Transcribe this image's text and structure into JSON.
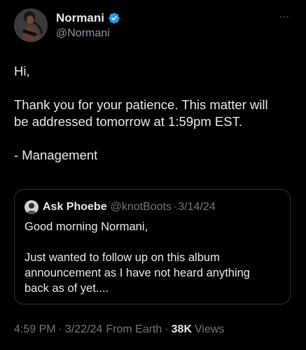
{
  "tweet": {
    "author": {
      "display_name": "Normani",
      "handle": "@Normani",
      "verified": true,
      "avatar_icon": "profile-photo"
    },
    "more_icon": "more-dots-icon",
    "text_lines": [
      "Hi,",
      "Thank you for your patience. This matter will",
      "be addressed tomorrow at 1:59pm EST.",
      "- Management"
    ],
    "quote": {
      "display_name": "Ask Phoebe",
      "handle": "@knotBoots",
      "separator": "·",
      "date": "3/14/24",
      "text_lines": [
        "Good morning Normani,",
        "Just wanted to follow up on this album",
        "announcement as I have not heard anything",
        "back as of yet...."
      ]
    },
    "meta": {
      "time": "4:59 PM",
      "date": "3/22/24",
      "source": "From Earth",
      "separator": "·",
      "views_count": "38K",
      "views_label": "Views"
    }
  },
  "colors": {
    "background": "#000000",
    "primary_text": "#e7e9ea",
    "secondary_text": "#71767b",
    "verified_badge": "#1d9bf0",
    "border": "#2f3336"
  }
}
